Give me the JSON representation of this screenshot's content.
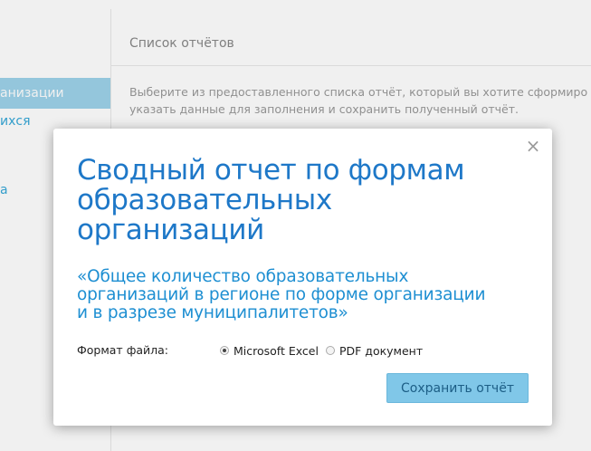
{
  "sidebar": {
    "items": [
      {
        "label": "анизации",
        "active": true
      },
      {
        "label": "ихся",
        "active": false
      },
      {
        "label": "а",
        "active": false
      }
    ]
  },
  "content": {
    "title": "Список отчётов",
    "description_lines": [
      "Выберите из предоставленного списка отчёт, который вы хотите сформиро",
      "указать данные для заполнения и сохранить полученный отчёт."
    ]
  },
  "modal": {
    "close_label": "×",
    "title_lines": [
      "Сводный отчет по формам",
      "образовательных",
      "организаций"
    ],
    "subtitle_lines": [
      "«Общее количество образовательных",
      "организаций в регионе по форме организации",
      "и в разрезе муниципалитетов»"
    ],
    "format_label": "Формат файла:",
    "format_options": [
      {
        "label": "Microsoft Excel",
        "checked": true
      },
      {
        "label": "PDF документ",
        "checked": false
      }
    ],
    "save_label": "Сохранить отчёт"
  },
  "colors": {
    "accent": "#1e78c8",
    "button": "#80c7e8",
    "sidebar_active": "#9ed3ea"
  }
}
